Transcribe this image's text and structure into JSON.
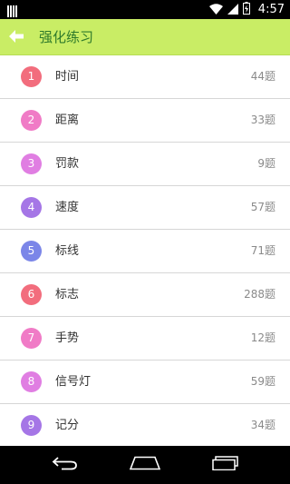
{
  "status_bar": {
    "time": "4:57",
    "icons": [
      "notification-icon",
      "wifi-icon",
      "signal-icon",
      "battery-icon"
    ]
  },
  "action_bar": {
    "title": "强化练习",
    "back_icon": "back-arrow-icon",
    "background_color": "#c9ed65",
    "title_color": "#2f7a2b"
  },
  "list": {
    "items": [
      {
        "number": "1",
        "label": "时间",
        "count": "44题",
        "color": "#f26d7d"
      },
      {
        "number": "2",
        "label": "距离",
        "count": "33题",
        "color": "#f07bc6"
      },
      {
        "number": "3",
        "label": "罚款",
        "count": "9题",
        "color": "#e07ee2"
      },
      {
        "number": "4",
        "label": "速度",
        "count": "57题",
        "color": "#a576e6"
      },
      {
        "number": "5",
        "label": "标线",
        "count": "71题",
        "color": "#7b86e8"
      },
      {
        "number": "6",
        "label": "标志",
        "count": "288题",
        "color": "#f26d7d"
      },
      {
        "number": "7",
        "label": "手势",
        "count": "12题",
        "color": "#f07bc6"
      },
      {
        "number": "8",
        "label": "信号灯",
        "count": "59题",
        "color": "#e07ee2"
      },
      {
        "number": "9",
        "label": "记分",
        "count": "34题",
        "color": "#a576e6"
      }
    ]
  },
  "nav_bar": {
    "buttons": [
      "back-nav-icon",
      "home-nav-icon",
      "recents-nav-icon"
    ]
  }
}
